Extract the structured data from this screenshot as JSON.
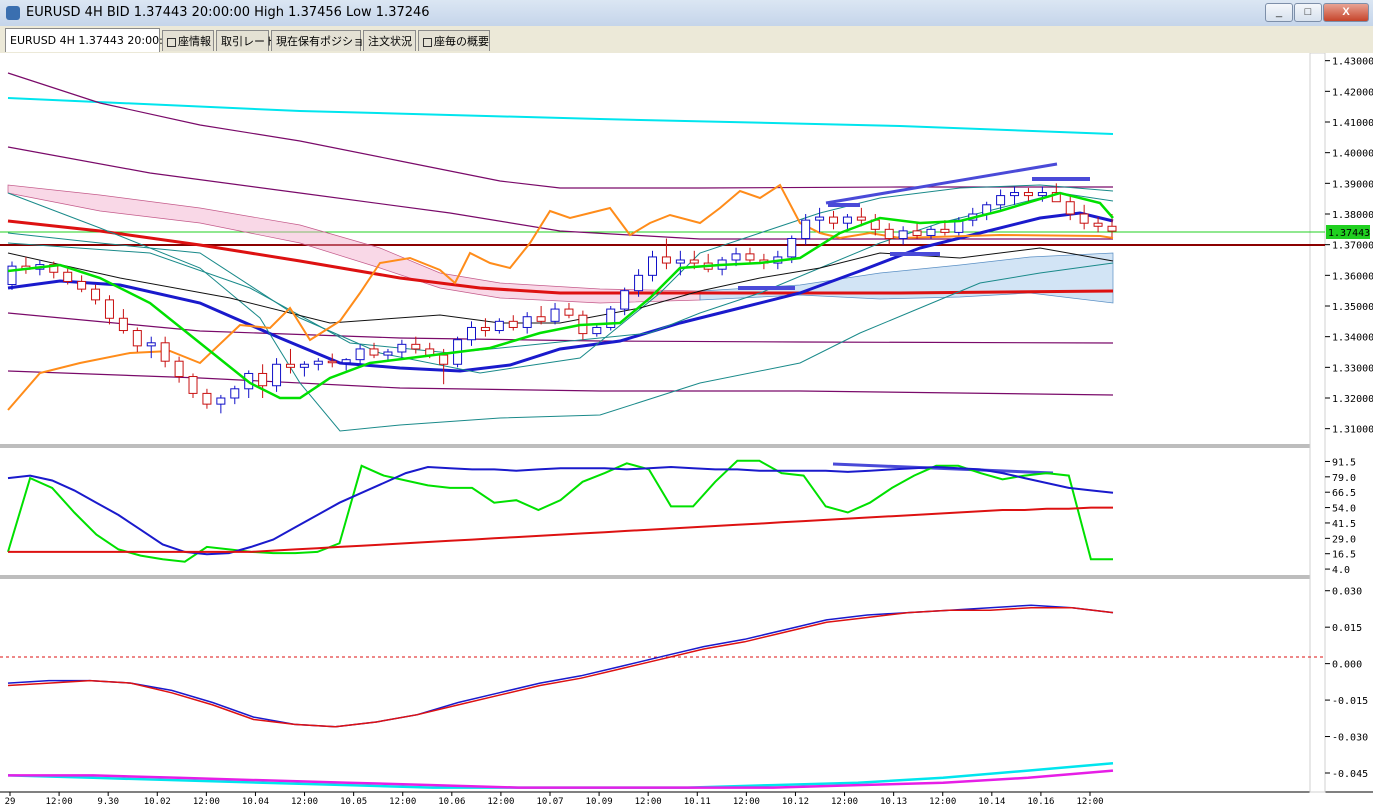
{
  "window": {
    "title": "EURUSD 4H BID 1.37443 20:00:00 High 1.37456 Low 1.37246",
    "minimize_label": "_",
    "maximize_label": "□",
    "close_label": "X"
  },
  "tabs": [
    {
      "label": "EURUSD 4H 1.37443 20:00:00",
      "icon": ""
    },
    {
      "label": "座情報",
      "icon": "checkbox-icon"
    },
    {
      "label": "取引レート",
      "icon": ""
    },
    {
      "label": "現在保有ポジション",
      "icon": ""
    },
    {
      "label": "注文状況",
      "icon": ""
    },
    {
      "label": "座毎の概要",
      "icon": "checkbox-icon"
    }
  ],
  "colors": {
    "bull": "#1010c8",
    "bear": "#c81010",
    "signal_green": "#00e000",
    "ma_blue": "#1a1acc",
    "ma_red": "#dd1111",
    "cyan": "#00e5ee",
    "purple": "#7a0a6a",
    "orange": "#ff8c1a",
    "dark_red": "#8b0000",
    "teal": "#1a8a8a",
    "black": "#111111",
    "magenta": "#e61ee6"
  },
  "price_scale": {
    "ticks": [
      "1.43000",
      "1.42000",
      "1.41000",
      "1.40000",
      "1.39000",
      "1.38000",
      "1.37000",
      "1.36000",
      "1.35000",
      "1.34000",
      "1.33000",
      "1.32000",
      "1.31000"
    ],
    "current_price": "1.37443"
  },
  "stoch_scale": {
    "ticks": [
      "91.5",
      "79.0",
      "66.5",
      "54.0",
      "41.5",
      "29.0",
      "16.5",
      "4.0"
    ]
  },
  "macd_scale": {
    "ticks": [
      "0.030",
      "0.015",
      "0.000",
      "-0.015",
      "-0.030",
      "-0.045"
    ]
  },
  "time_axis": {
    "labels": [
      "29",
      "12:00",
      "9.30",
      "10.02",
      "12:00",
      "10.04",
      "12:00",
      "10.05",
      "12:00",
      "10.06",
      "12:00",
      "10.07",
      "10.09",
      "12:00",
      "10.11",
      "12:00",
      "10.12",
      "12:00",
      "10.13",
      "12:00",
      "10.14",
      "10.16",
      "12:00"
    ]
  },
  "chart_data": [
    {
      "type": "candlestick",
      "title": "EURUSD 4H",
      "ylim": [
        1.305,
        1.4325
      ],
      "current_price": 1.37443,
      "horizontal_line": 1.3693,
      "candles": [
        [
          1.357,
          1.3645,
          1.3552,
          1.363
        ],
        [
          1.363,
          1.366,
          1.3605,
          1.362
        ],
        [
          1.362,
          1.365,
          1.36,
          1.3635
        ],
        [
          1.3635,
          1.3645,
          1.359,
          1.361
        ],
        [
          1.361,
          1.3625,
          1.357,
          1.358
        ],
        [
          1.358,
          1.36,
          1.3545,
          1.3555
        ],
        [
          1.3555,
          1.357,
          1.3505,
          1.352
        ],
        [
          1.352,
          1.3535,
          1.344,
          1.346
        ],
        [
          1.346,
          1.349,
          1.341,
          1.342
        ],
        [
          1.342,
          1.343,
          1.335,
          1.337
        ],
        [
          1.337,
          1.34,
          1.333,
          1.338
        ],
        [
          1.338,
          1.34,
          1.33,
          1.332
        ],
        [
          1.332,
          1.3335,
          1.325,
          1.327
        ],
        [
          1.327,
          1.328,
          1.32,
          1.3215
        ],
        [
          1.3215,
          1.323,
          1.3165,
          1.318
        ],
        [
          1.318,
          1.321,
          1.315,
          1.32
        ],
        [
          1.32,
          1.324,
          1.318,
          1.323
        ],
        [
          1.323,
          1.329,
          1.32,
          1.328
        ],
        [
          1.328,
          1.331,
          1.32,
          1.324
        ],
        [
          1.324,
          1.333,
          1.322,
          1.331
        ],
        [
          1.331,
          1.336,
          1.328,
          1.33
        ],
        [
          1.33,
          1.332,
          1.327,
          1.331
        ],
        [
          1.331,
          1.333,
          1.329,
          1.332
        ],
        [
          1.332,
          1.3345,
          1.33,
          1.3315
        ],
        [
          1.3315,
          1.333,
          1.329,
          1.3325
        ],
        [
          1.3325,
          1.3375,
          1.331,
          1.336
        ],
        [
          1.336,
          1.338,
          1.333,
          1.334
        ],
        [
          1.334,
          1.336,
          1.332,
          1.335
        ],
        [
          1.335,
          1.339,
          1.333,
          1.3375
        ],
        [
          1.3375,
          1.34,
          1.3345,
          1.336
        ],
        [
          1.336,
          1.338,
          1.333,
          1.334
        ],
        [
          1.334,
          1.336,
          1.3245,
          1.331
        ],
        [
          1.331,
          1.34,
          1.33,
          1.339
        ],
        [
          1.339,
          1.345,
          1.337,
          1.343
        ],
        [
          1.343,
          1.346,
          1.34,
          1.342
        ],
        [
          1.342,
          1.346,
          1.341,
          1.345
        ],
        [
          1.345,
          1.347,
          1.342,
          1.343
        ],
        [
          1.343,
          1.348,
          1.341,
          1.3465
        ],
        [
          1.3465,
          1.35,
          1.344,
          1.345
        ],
        [
          1.345,
          1.351,
          1.344,
          1.349
        ],
        [
          1.349,
          1.351,
          1.346,
          1.347
        ],
        [
          1.347,
          1.3485,
          1.339,
          1.341
        ],
        [
          1.341,
          1.344,
          1.34,
          1.343
        ],
        [
          1.343,
          1.35,
          1.342,
          1.349
        ],
        [
          1.349,
          1.356,
          1.347,
          1.355
        ],
        [
          1.355,
          1.362,
          1.353,
          1.36
        ],
        [
          1.36,
          1.368,
          1.358,
          1.366
        ],
        [
          1.366,
          1.372,
          1.362,
          1.364
        ],
        [
          1.364,
          1.368,
          1.36,
          1.365
        ],
        [
          1.365,
          1.368,
          1.362,
          1.364
        ],
        [
          1.364,
          1.367,
          1.361,
          1.362
        ],
        [
          1.362,
          1.366,
          1.36,
          1.365
        ],
        [
          1.365,
          1.369,
          1.363,
          1.367
        ],
        [
          1.367,
          1.369,
          1.364,
          1.365
        ],
        [
          1.365,
          1.367,
          1.362,
          1.364
        ],
        [
          1.364,
          1.368,
          1.362,
          1.366
        ],
        [
          1.366,
          1.373,
          1.364,
          1.372
        ],
        [
          1.372,
          1.38,
          1.37,
          1.378
        ],
        [
          1.378,
          1.382,
          1.374,
          1.379
        ],
        [
          1.379,
          1.381,
          1.375,
          1.377
        ],
        [
          1.377,
          1.38,
          1.375,
          1.379
        ],
        [
          1.379,
          1.382,
          1.376,
          1.378
        ],
        [
          1.378,
          1.38,
          1.373,
          1.375
        ],
        [
          1.375,
          1.377,
          1.37,
          1.372
        ],
        [
          1.372,
          1.376,
          1.37,
          1.3745
        ],
        [
          1.3745,
          1.377,
          1.372,
          1.373
        ],
        [
          1.373,
          1.376,
          1.372,
          1.375
        ],
        [
          1.375,
          1.378,
          1.373,
          1.374
        ],
        [
          1.374,
          1.379,
          1.373,
          1.378
        ],
        [
          1.378,
          1.382,
          1.376,
          1.38
        ],
        [
          1.38,
          1.384,
          1.378,
          1.383
        ],
        [
          1.383,
          1.388,
          1.381,
          1.386
        ],
        [
          1.386,
          1.389,
          1.383,
          1.387
        ],
        [
          1.387,
          1.3885,
          1.384,
          1.386
        ],
        [
          1.386,
          1.389,
          1.384,
          1.387
        ],
        [
          1.387,
          1.39,
          1.385,
          1.384
        ],
        [
          1.384,
          1.386,
          1.378,
          1.38
        ],
        [
          1.38,
          1.383,
          1.375,
          1.377
        ],
        [
          1.377,
          1.379,
          1.374,
          1.376
        ],
        [
          1.376,
          1.38,
          1.3725,
          1.37443
        ]
      ]
    },
    {
      "type": "line",
      "title": "Stochastic",
      "ylim": [
        0,
        100
      ],
      "series": [
        {
          "values": [
            18,
            78,
            70,
            50,
            32,
            20,
            15,
            12,
            10,
            22,
            20,
            18,
            17,
            17,
            18,
            25,
            88,
            80,
            76,
            72,
            70,
            70,
            58,
            60,
            52,
            60,
            75,
            82,
            90,
            85,
            55,
            55,
            75,
            92,
            92,
            82,
            80,
            55,
            50,
            58,
            70,
            80,
            88,
            88,
            82,
            77,
            80,
            82,
            80,
            12,
            12
          ]
        },
        {
          "values": [
            78,
            80,
            76,
            68,
            58,
            48,
            36,
            24,
            18,
            16,
            17,
            22,
            28,
            38,
            48,
            58,
            66,
            74,
            82,
            87,
            86,
            85,
            85,
            84,
            85,
            86,
            86,
            86,
            85,
            86,
            87,
            86,
            85,
            85,
            84,
            84,
            84,
            84,
            83,
            84,
            85,
            86,
            87,
            86,
            85,
            82,
            78,
            74,
            70,
            68,
            66
          ]
        },
        {
          "values": [
            18,
            18,
            18,
            18,
            18,
            18,
            18,
            18,
            18,
            18,
            18,
            18,
            19,
            20,
            21,
            22,
            23,
            24,
            25,
            26,
            27,
            28,
            29,
            30,
            31,
            32,
            33,
            34,
            35,
            36,
            37,
            38,
            39,
            40,
            41,
            42,
            43,
            44,
            45,
            46,
            47,
            48,
            49,
            50,
            51,
            52,
            52,
            53,
            53,
            54,
            54
          ]
        }
      ]
    },
    {
      "type": "line",
      "title": "MACD",
      "ylim": [
        -0.052,
        0.034
      ],
      "series": [
        {
          "values": [
            -0.008,
            -0.007,
            -0.007,
            -0.008,
            -0.011,
            -0.016,
            -0.022,
            -0.025,
            -0.026,
            -0.024,
            -0.021,
            -0.016,
            -0.012,
            -0.008,
            -0.005,
            -0.001,
            0.003,
            0.007,
            0.01,
            0.014,
            0.018,
            0.02,
            0.021,
            0.022,
            0.023,
            0.024,
            0.023,
            0.021
          ]
        },
        {
          "values": [
            -0.009,
            -0.008,
            -0.007,
            -0.008,
            -0.012,
            -0.017,
            -0.023,
            -0.025,
            -0.026,
            -0.024,
            -0.021,
            -0.017,
            -0.013,
            -0.009,
            -0.006,
            -0.002,
            0.002,
            0.006,
            0.009,
            0.013,
            0.017,
            0.019,
            0.021,
            0.022,
            0.022,
            0.023,
            0.023,
            0.021
          ]
        },
        {
          "values": [
            -0.046,
            -0.047,
            -0.048,
            -0.049,
            -0.05,
            -0.051,
            -0.051,
            -0.051,
            -0.051,
            -0.05,
            -0.049,
            -0.047,
            -0.044,
            -0.041
          ]
        },
        {
          "values": [
            -0.046,
            -0.046,
            -0.047,
            -0.048,
            -0.049,
            -0.05,
            -0.051,
            -0.051,
            -0.051,
            -0.051,
            -0.05,
            -0.049,
            -0.047,
            -0.044
          ]
        }
      ]
    }
  ]
}
